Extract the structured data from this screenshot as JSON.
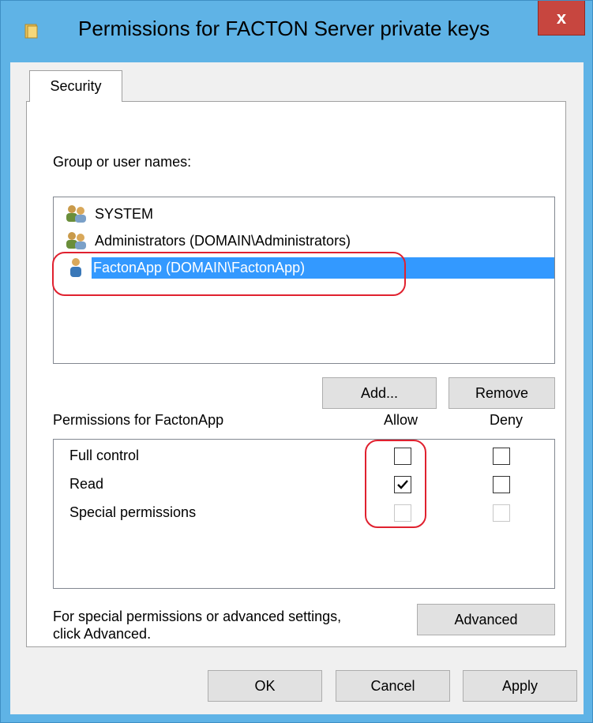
{
  "window": {
    "title": "Permissions for FACTON Server private keys",
    "close_label": "x"
  },
  "tabs": [
    {
      "label": "Security"
    }
  ],
  "group_list": {
    "label": "Group or user names:",
    "items": [
      {
        "name": "SYSTEM",
        "icon": "users-icon"
      },
      {
        "name": "Administrators (DOMAIN\\Administrators)",
        "icon": "users-icon"
      },
      {
        "name": "FactonApp (DOMAIN\\FactonApp)",
        "icon": "user-icon",
        "selected": true
      }
    ]
  },
  "buttons": {
    "add": "Add...",
    "remove": "Remove",
    "advanced": "Advanced",
    "ok": "OK",
    "cancel": "Cancel",
    "apply": "Apply"
  },
  "permissions": {
    "label": "Permissions for FactonApp",
    "allow_header": "Allow",
    "deny_header": "Deny",
    "rows": [
      {
        "name": "Full control",
        "allow": false,
        "deny": false,
        "disabled": false
      },
      {
        "name": "Read",
        "allow": true,
        "deny": false,
        "disabled": false
      },
      {
        "name": "Special permissions",
        "allow": false,
        "deny": false,
        "disabled": true
      }
    ]
  },
  "advanced_note": {
    "line1": "For special permissions or advanced settings,",
    "line2": "click Advanced."
  },
  "colors": {
    "titlebar": "#5fb3e6",
    "selection": "#3399ff",
    "annotation": "#e0212f",
    "close_button": "#c7463f"
  }
}
